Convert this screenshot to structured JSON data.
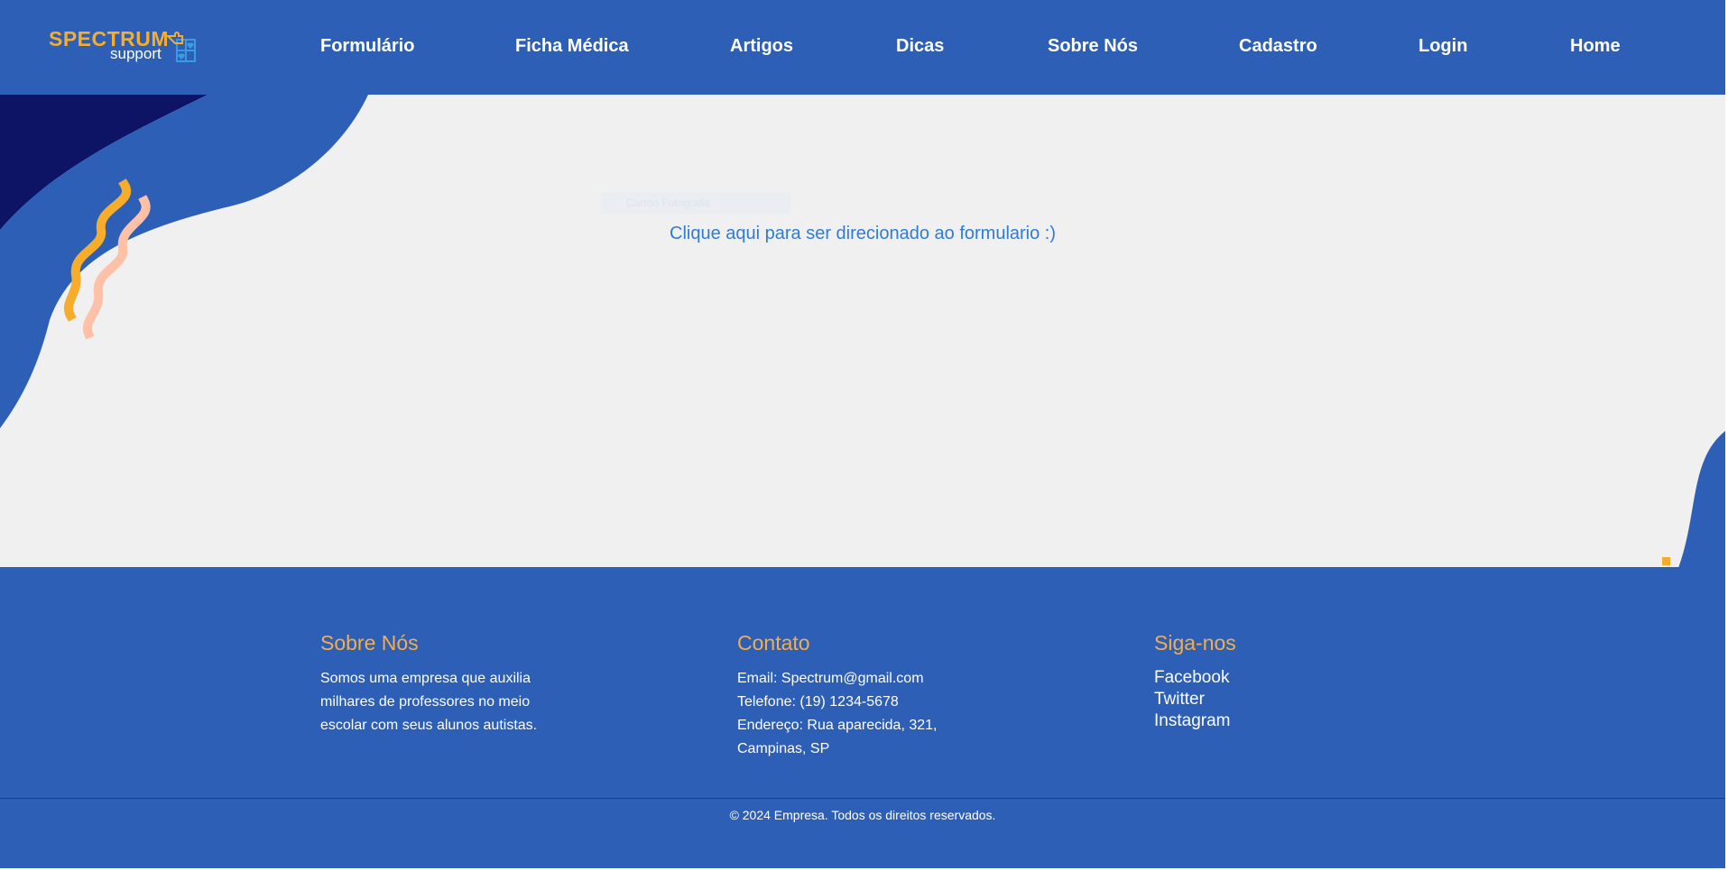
{
  "header": {
    "logo": {
      "title": "SPECTRUM",
      "subtitle": "support",
      "icon": "puzzle-heart-icon"
    },
    "nav": [
      {
        "label": "Formulário"
      },
      {
        "label": "Ficha Médica"
      },
      {
        "label": "Artigos"
      },
      {
        "label": "Dicas"
      },
      {
        "label": "Sobre Nós"
      },
      {
        "label": "Cadastro"
      },
      {
        "label": "Login"
      },
      {
        "label": "Home"
      }
    ]
  },
  "main": {
    "form_link_text": "Clique aqui para ser direcionado ao formulario :)",
    "ghost_label": "Cartoo Fotografia"
  },
  "footer": {
    "about": {
      "title": "Sobre Nós",
      "lines": [
        "Somos uma empresa que auxilia",
        "milhares de professores no meio",
        "escolar com seus alunos autistas."
      ]
    },
    "contact": {
      "title": "Contato",
      "lines": [
        "Email: Spectrum@gmail.com",
        "Telefone: (19) 1234-5678",
        "Endereço: Rua aparecida, 321,",
        "Campinas, SP"
      ]
    },
    "social": {
      "title": "Siga-nos",
      "links": [
        "Facebook",
        "Twitter",
        "Instagram"
      ]
    },
    "copyright": "© 2024 Empresa. Todos os direitos reservados."
  },
  "colors": {
    "primary_blue": "#2d5fb6",
    "dark_navy": "#0d1466",
    "accent_orange": "#f5ad2b",
    "accent_peach": "#ffc0a8",
    "link_blue": "#2f7bd6",
    "background": "#f0f0f0"
  }
}
